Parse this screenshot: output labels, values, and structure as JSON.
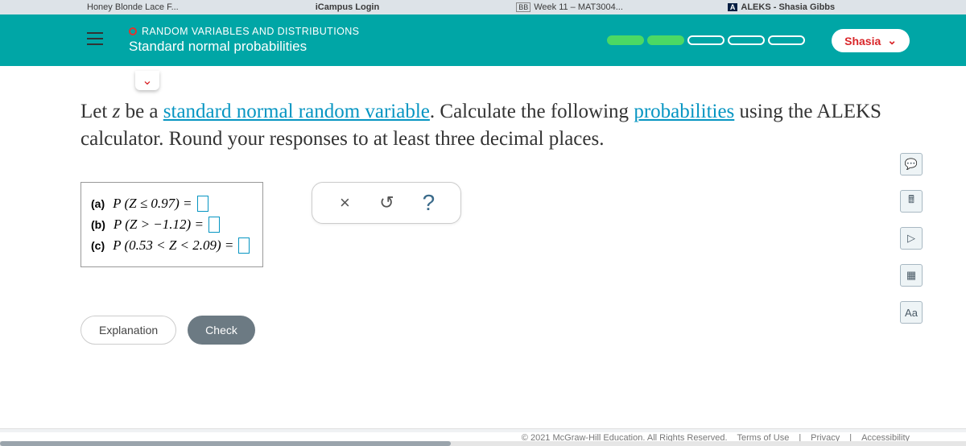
{
  "tabs": {
    "t1": "Honey Blonde Lace F...",
    "t2": "iCampus Login",
    "t3": "Week 11 – MAT3004...",
    "t4": "ALEKS - Shasia Gibbs"
  },
  "header": {
    "section": "RANDOM VARIABLES AND DISTRIBUTIONS",
    "topic": "Standard normal probabilities",
    "user": "Shasia"
  },
  "prompt": {
    "p1a": "Let ",
    "zvar": "z",
    "p1b": " be a ",
    "link1": "standard normal random variable",
    "p1c": ". Calculate the following ",
    "link2": "probabilities",
    "p1d": " using the ALEKS calculator. Round your responses to at least three decimal places."
  },
  "parts": {
    "a_label": "(a)",
    "a_expr": "P (Z ≤ 0.97) =",
    "b_label": "(b)",
    "b_expr": "P (Z > −1.12) =",
    "c_label": "(c)",
    "c_expr": "P (0.53 < Z < 2.09) ="
  },
  "tools": {
    "clear": "×",
    "reset": "↺",
    "help": "?"
  },
  "buttons": {
    "explanation": "Explanation",
    "check": "Check"
  },
  "rail": {
    "chat": "💬",
    "calc": "🖩",
    "video": "▷",
    "grid": "▦",
    "aa": "Aa"
  },
  "footer": {
    "copyright": "© 2021 McGraw-Hill Education. All Rights Reserved.",
    "terms": "Terms of Use",
    "privacy": "Privacy",
    "access": "Accessibility"
  }
}
